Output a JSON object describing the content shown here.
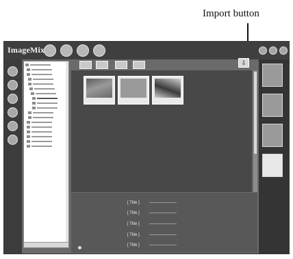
{
  "caption": "Import button",
  "window": {
    "app_title": "ImageMixer",
    "window_controls": [
      "minimize-icon",
      "help-icon",
      "close-icon"
    ]
  },
  "toolbar": {
    "import_icon": "import-icon"
  },
  "browse": {
    "thumbnails": [
      {
        "label": ""
      },
      {
        "label": ""
      },
      {
        "label": ""
      }
    ]
  },
  "info": {
    "fields": [
      "[ Title ]",
      "[ Title ]",
      "[ Title ]",
      "[ Title ]",
      "[ Title ]"
    ],
    "checkbox_label": ""
  },
  "tray": {
    "items": [
      {
        "label": ""
      },
      {
        "label": ""
      },
      {
        "label": ""
      },
      {
        "label": ""
      }
    ]
  }
}
